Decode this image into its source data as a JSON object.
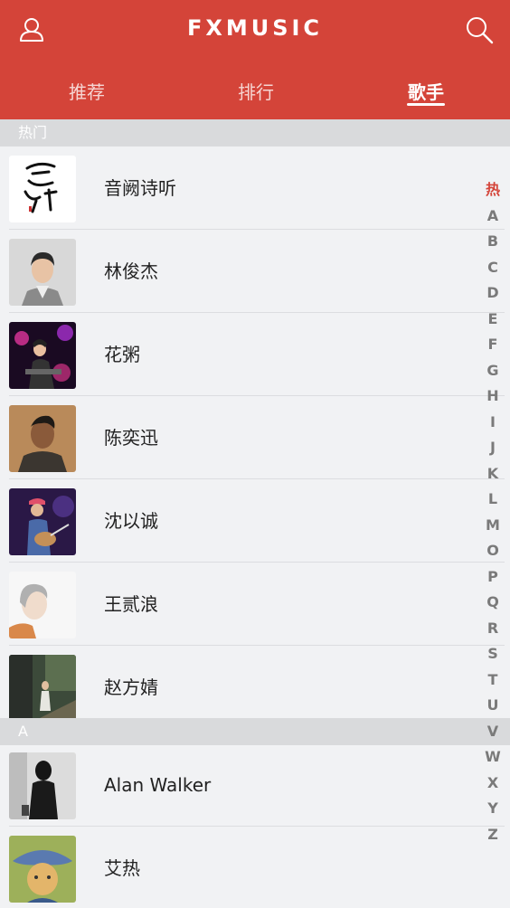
{
  "header": {
    "title": "FXMUSIC",
    "user_icon": "user-icon",
    "search_icon": "search-icon",
    "accent_color": "#d44439"
  },
  "tabs": [
    {
      "label": "推荐",
      "active": false
    },
    {
      "label": "排行",
      "active": false
    },
    {
      "label": "歌手",
      "active": true
    }
  ],
  "groups": [
    {
      "title": "热门",
      "singers": [
        {
          "name": "音阙诗听"
        },
        {
          "name": "林俊杰"
        },
        {
          "name": "花粥"
        },
        {
          "name": "陈奕迅"
        },
        {
          "name": "沈以诚"
        },
        {
          "name": "王贰浪"
        },
        {
          "name": "赵方婧"
        }
      ]
    },
    {
      "title": "A",
      "singers": [
        {
          "name": "Alan Walker"
        },
        {
          "name": "艾热"
        }
      ]
    }
  ],
  "index": [
    "热",
    "A",
    "B",
    "C",
    "D",
    "E",
    "F",
    "G",
    "H",
    "I",
    "J",
    "K",
    "L",
    "M",
    "O",
    "P",
    "Q",
    "R",
    "S",
    "T",
    "U",
    "V",
    "W",
    "X",
    "Y",
    "Z"
  ]
}
